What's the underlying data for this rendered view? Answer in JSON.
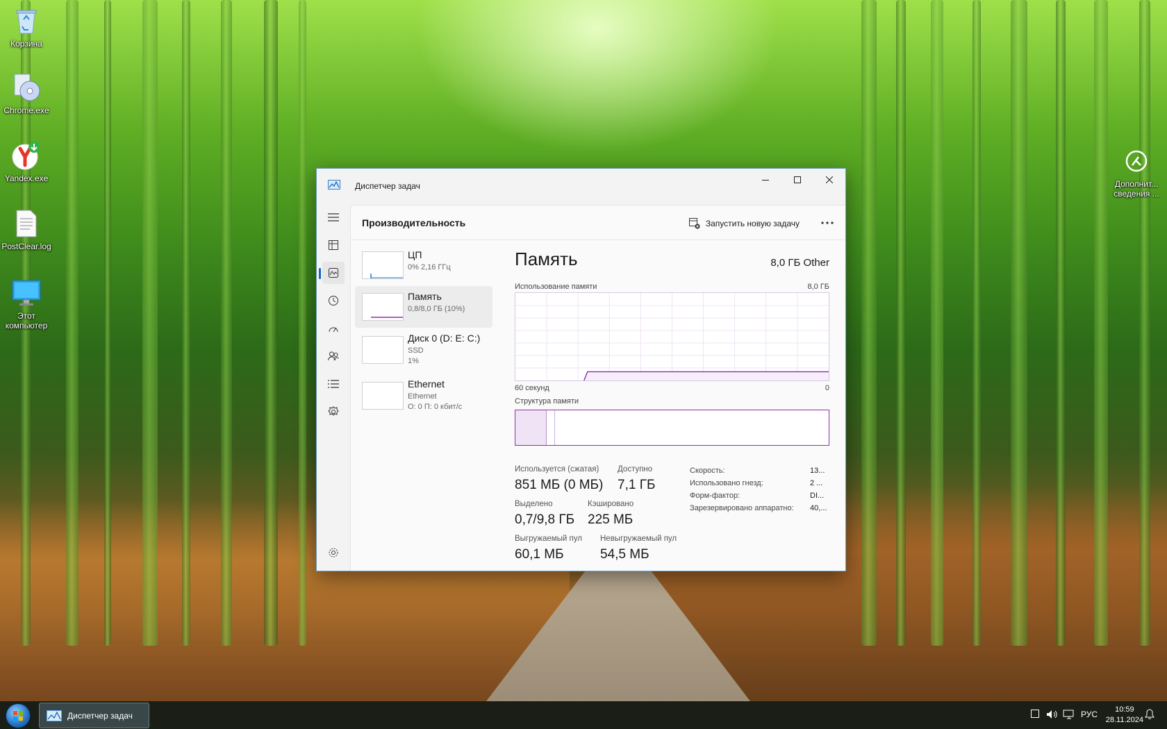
{
  "desktop": {
    "icons": [
      {
        "label": "Корзина",
        "icon": "recycle-bin-icon"
      },
      {
        "label": "Chrome.exe",
        "icon": "installer-cd-icon"
      },
      {
        "label": "Yandex.exe",
        "icon": "yandex-browser-icon"
      },
      {
        "label": "PostClear.log",
        "icon": "text-file-icon"
      },
      {
        "label": "Этот компьютер",
        "icon": "computer-icon"
      },
      {
        "label": "Дополнит... сведения ...",
        "icon": "info-circle-icon"
      }
    ]
  },
  "window": {
    "title": "Диспетчер задач",
    "controls": {
      "minimize": "minimize-icon",
      "maximize": "maximize-icon",
      "close": "close-icon"
    }
  },
  "nav": {
    "items": [
      "hamburger-menu-icon",
      "processes-icon",
      "performance-icon",
      "app-history-icon",
      "startup-apps-icon",
      "users-icon",
      "details-icon",
      "services-icon"
    ],
    "active": "performance-icon",
    "settings": "settings-gear-icon"
  },
  "header": {
    "title": "Производительность",
    "run_task": "Запустить новую задачу",
    "more": "more-options-icon"
  },
  "devices": [
    {
      "name": "ЦП",
      "sub1": "0% 2,16 ГГц",
      "sub2": ""
    },
    {
      "name": "Память",
      "sub1": "0,8/8,0 ГБ (10%)",
      "sub2": ""
    },
    {
      "name": "Диск 0 (D: E: C:)",
      "sub1": "SSD",
      "sub2": "1%"
    },
    {
      "name": "Ethernet",
      "sub1": "Ethernet",
      "sub2": "О: 0 П: 0 кбит/с"
    }
  ],
  "memory": {
    "title": "Память",
    "total": "8,0 ГБ Other",
    "usage_label": "Использование памяти",
    "usage_max": "8,0 ГБ",
    "time_left": "60 секунд",
    "time_right": "0",
    "composition_label": "Структура памяти",
    "usage_fraction": 0.1,
    "stats": {
      "in_use_label": "Используется (сжатая)",
      "in_use_value": "851 МБ (0 МБ)",
      "available_label": "Доступно",
      "available_value": "7,1 ГБ",
      "committed_label": "Выделено",
      "committed_value": "0,7/9,8 ГБ",
      "cached_label": "Кэшировано",
      "cached_value": "225 МБ",
      "paged_label": "Выгружаемый пул",
      "paged_value": "60,1 МБ",
      "nonpaged_label": "Невыгружаемый пул",
      "nonpaged_value": "54,5 МБ"
    },
    "props": [
      {
        "label": "Скорость:",
        "value": "13..."
      },
      {
        "label": "Использовано гнезд:",
        "value": "2 ..."
      },
      {
        "label": "Форм-фактор:",
        "value": "DI..."
      },
      {
        "label": "Зарезервировано аппаратно:",
        "value": "40,..."
      }
    ],
    "accent": "#8b2fa8"
  },
  "taskbar": {
    "task_label": "Диспетчер задач",
    "lang": "РУС",
    "time": "10:59",
    "date": "28.11.2024"
  }
}
